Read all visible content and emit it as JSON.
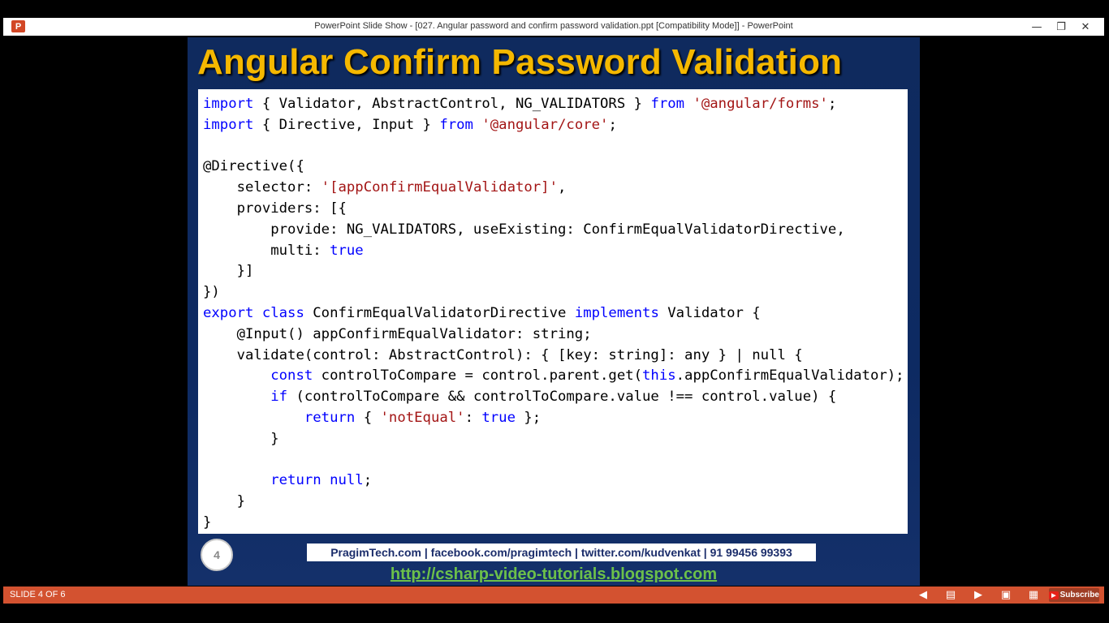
{
  "window": {
    "app_icon_glyph": "P",
    "title": "PowerPoint Slide Show - [027. Angular password and confirm password validation.ppt [Compatibility Mode]] - PowerPoint",
    "minimize_glyph": "—",
    "restore_glyph": "❐",
    "close_glyph": "✕"
  },
  "slide": {
    "title": "Angular Confirm Password Validation",
    "code_lines": [
      [
        {
          "t": "import",
          "c": "kw"
        },
        {
          "t": " { Validator, AbstractControl, NG_VALIDATORS } "
        },
        {
          "t": "from",
          "c": "kw"
        },
        {
          "t": " "
        },
        {
          "t": "'@angular/forms'",
          "c": "str"
        },
        {
          "t": ";"
        }
      ],
      [
        {
          "t": "import",
          "c": "kw"
        },
        {
          "t": " { Directive, Input } "
        },
        {
          "t": "from",
          "c": "kw"
        },
        {
          "t": " "
        },
        {
          "t": "'@angular/core'",
          "c": "str"
        },
        {
          "t": ";"
        }
      ],
      [],
      [
        {
          "t": "@Directive({"
        }
      ],
      [
        {
          "t": "    selector: "
        },
        {
          "t": "'[appConfirmEqualValidator]'",
          "c": "str"
        },
        {
          "t": ","
        }
      ],
      [
        {
          "t": "    providers: [{"
        }
      ],
      [
        {
          "t": "        provide: NG_VALIDATORS, useExisting: ConfirmEqualValidatorDirective,"
        }
      ],
      [
        {
          "t": "        multi: "
        },
        {
          "t": "true",
          "c": "kw"
        }
      ],
      [
        {
          "t": "    }]"
        }
      ],
      [
        {
          "t": "})"
        }
      ],
      [
        {
          "t": "export",
          "c": "kw"
        },
        {
          "t": " "
        },
        {
          "t": "class",
          "c": "kw"
        },
        {
          "t": " ConfirmEqualValidatorDirective "
        },
        {
          "t": "implements",
          "c": "kw"
        },
        {
          "t": " Validator {"
        }
      ],
      [
        {
          "t": "    @Input() appConfirmEqualValidator: string;"
        }
      ],
      [
        {
          "t": "    validate(control: AbstractControl): { [key: string]: any } | null {"
        }
      ],
      [
        {
          "t": "        "
        },
        {
          "t": "const",
          "c": "kw"
        },
        {
          "t": " controlToCompare = control.parent.get("
        },
        {
          "t": "this",
          "c": "kw"
        },
        {
          "t": ".appConfirmEqualValidator);"
        }
      ],
      [
        {
          "t": "        "
        },
        {
          "t": "if",
          "c": "kw"
        },
        {
          "t": " (controlToCompare && controlToCompare.value !== control.value) {"
        }
      ],
      [
        {
          "t": "            "
        },
        {
          "t": "return",
          "c": "kw"
        },
        {
          "t": " { "
        },
        {
          "t": "'notEqual'",
          "c": "str"
        },
        {
          "t": ": "
        },
        {
          "t": "true",
          "c": "kw"
        },
        {
          "t": " };"
        }
      ],
      [
        {
          "t": "        }"
        }
      ],
      [],
      [
        {
          "t": "        "
        },
        {
          "t": "return",
          "c": "kw"
        },
        {
          "t": " "
        },
        {
          "t": "null",
          "c": "kw"
        },
        {
          "t": ";"
        }
      ],
      [
        {
          "t": "    }"
        }
      ],
      [
        {
          "t": "}"
        }
      ]
    ],
    "slide_number": "4",
    "footer_info": "PragimTech.com | facebook.com/pragimtech | twitter.com/kudvenkat | 91 99456 99393",
    "footer_link": "http://csharp-video-tutorials.blogspot.com"
  },
  "statusbar": {
    "slide_counter": "SLIDE 4 OF 6",
    "icons": [
      "previous-icon",
      "notes-icon",
      "next-icon",
      "normal-view-icon",
      "slide-sorter-icon"
    ],
    "subscribe_label": "Subscribe"
  },
  "colors": {
    "title": "#f5b800",
    "keyword": "#0000ff",
    "string": "#a31515",
    "statusbar": "#d35230",
    "link": "#6cc04a"
  }
}
